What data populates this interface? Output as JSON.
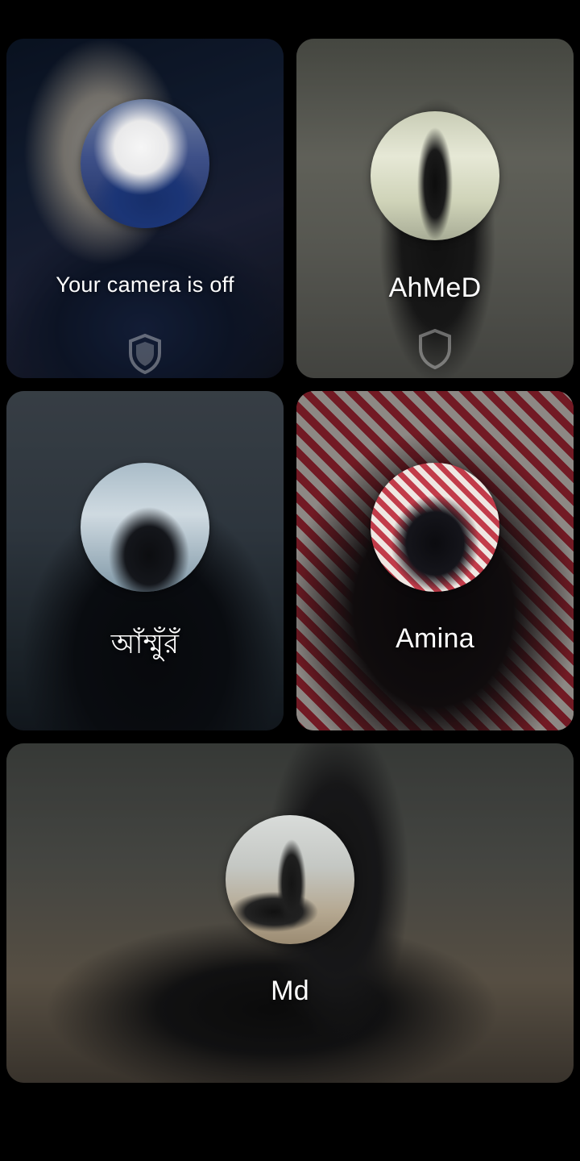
{
  "participants": [
    {
      "label": "Your camera is off",
      "is_self": true
    },
    {
      "label": "AhMeD"
    },
    {
      "label": "আঁম্মুঁরঁ"
    },
    {
      "label": "Amina"
    },
    {
      "label": "Md"
    }
  ]
}
